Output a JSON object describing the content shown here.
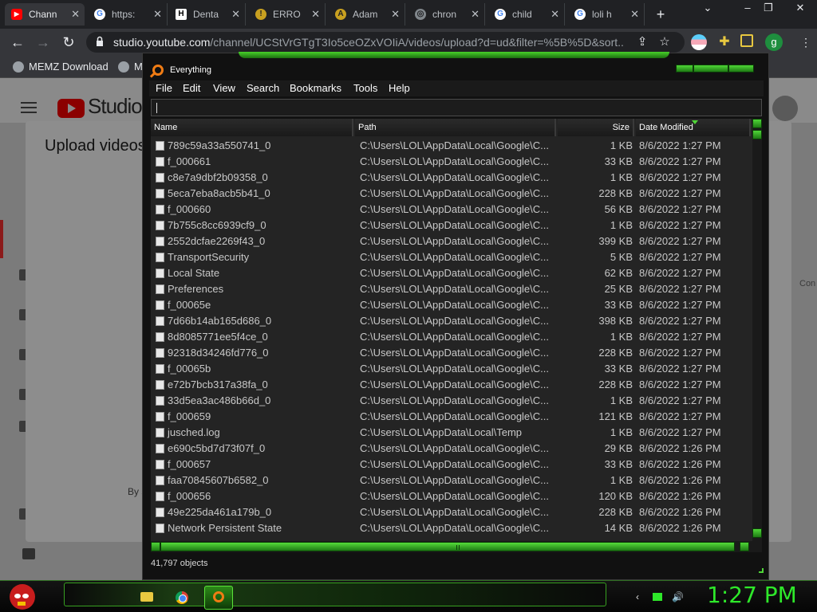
{
  "browser": {
    "tabs": [
      {
        "label": "Chann",
        "favicon": "youtube-icon",
        "active": true
      },
      {
        "label": "https:",
        "favicon": "google-icon",
        "active": false
      },
      {
        "label": "Denta",
        "favicon": "h-icon",
        "active": false
      },
      {
        "label": "ERRO",
        "favicon": "error-icon",
        "active": false
      },
      {
        "label": "Adam",
        "favicon": "adam-icon",
        "active": false
      },
      {
        "label": "chron",
        "favicon": "globe-icon",
        "active": false
      },
      {
        "label": "child",
        "favicon": "google-icon",
        "active": false
      },
      {
        "label": "loli h",
        "favicon": "google-icon",
        "active": false
      }
    ],
    "new_tab": "+",
    "url_domain": "studio.youtube.com",
    "url_path": "/channel/UCStVrGTgT3Io5ceOZxVOIiA/videos/upload?d=ud&filter=%5B%5D&sort...",
    "profile_initial": "g",
    "bookmarks": [
      "MEMZ Download",
      "M"
    ]
  },
  "studio": {
    "logo_text": "Studio",
    "dialog_title": "Upload videos",
    "dialog_footer": "By s",
    "side_text": "Con"
  },
  "everything": {
    "title": "Everything",
    "menu": [
      "File",
      "Edit",
      "View",
      "Search",
      "Bookmarks",
      "Tools",
      "Help"
    ],
    "search_value": "",
    "columns": {
      "name": "Name",
      "path": "Path",
      "size": "Size",
      "date": "Date Modified"
    },
    "rows": [
      {
        "name": "789c59a33a550741_0",
        "path": "C:\\Users\\LOL\\AppData\\Local\\Google\\C...",
        "size": "1 KB",
        "date": "8/6/2022 1:27 PM"
      },
      {
        "name": "f_000661",
        "path": "C:\\Users\\LOL\\AppData\\Local\\Google\\C...",
        "size": "33 KB",
        "date": "8/6/2022 1:27 PM"
      },
      {
        "name": "c8e7a9dbf2b09358_0",
        "path": "C:\\Users\\LOL\\AppData\\Local\\Google\\C...",
        "size": "1 KB",
        "date": "8/6/2022 1:27 PM"
      },
      {
        "name": "5eca7eba8acb5b41_0",
        "path": "C:\\Users\\LOL\\AppData\\Local\\Google\\C...",
        "size": "228 KB",
        "date": "8/6/2022 1:27 PM"
      },
      {
        "name": "f_000660",
        "path": "C:\\Users\\LOL\\AppData\\Local\\Google\\C...",
        "size": "56 KB",
        "date": "8/6/2022 1:27 PM"
      },
      {
        "name": "7b755c8cc6939cf9_0",
        "path": "C:\\Users\\LOL\\AppData\\Local\\Google\\C...",
        "size": "1 KB",
        "date": "8/6/2022 1:27 PM"
      },
      {
        "name": "2552dcfae2269f43_0",
        "path": "C:\\Users\\LOL\\AppData\\Local\\Google\\C...",
        "size": "399 KB",
        "date": "8/6/2022 1:27 PM"
      },
      {
        "name": "TransportSecurity",
        "path": "C:\\Users\\LOL\\AppData\\Local\\Google\\C...",
        "size": "5 KB",
        "date": "8/6/2022 1:27 PM"
      },
      {
        "name": "Local State",
        "path": "C:\\Users\\LOL\\AppData\\Local\\Google\\C...",
        "size": "62 KB",
        "date": "8/6/2022 1:27 PM"
      },
      {
        "name": "Preferences",
        "path": "C:\\Users\\LOL\\AppData\\Local\\Google\\C...",
        "size": "25 KB",
        "date": "8/6/2022 1:27 PM"
      },
      {
        "name": "f_00065e",
        "path": "C:\\Users\\LOL\\AppData\\Local\\Google\\C...",
        "size": "33 KB",
        "date": "8/6/2022 1:27 PM"
      },
      {
        "name": "7d66b14ab165d686_0",
        "path": "C:\\Users\\LOL\\AppData\\Local\\Google\\C...",
        "size": "398 KB",
        "date": "8/6/2022 1:27 PM"
      },
      {
        "name": "8d8085771ee5f4ce_0",
        "path": "C:\\Users\\LOL\\AppData\\Local\\Google\\C...",
        "size": "1 KB",
        "date": "8/6/2022 1:27 PM"
      },
      {
        "name": "92318d34246fd776_0",
        "path": "C:\\Users\\LOL\\AppData\\Local\\Google\\C...",
        "size": "228 KB",
        "date": "8/6/2022 1:27 PM"
      },
      {
        "name": "f_00065b",
        "path": "C:\\Users\\LOL\\AppData\\Local\\Google\\C...",
        "size": "33 KB",
        "date": "8/6/2022 1:27 PM"
      },
      {
        "name": "e72b7bcb317a38fa_0",
        "path": "C:\\Users\\LOL\\AppData\\Local\\Google\\C...",
        "size": "228 KB",
        "date": "8/6/2022 1:27 PM"
      },
      {
        "name": "33d5ea3ac486b66d_0",
        "path": "C:\\Users\\LOL\\AppData\\Local\\Google\\C...",
        "size": "1 KB",
        "date": "8/6/2022 1:27 PM"
      },
      {
        "name": "f_000659",
        "path": "C:\\Users\\LOL\\AppData\\Local\\Google\\C...",
        "size": "121 KB",
        "date": "8/6/2022 1:27 PM"
      },
      {
        "name": "jusched.log",
        "path": "C:\\Users\\LOL\\AppData\\Local\\Temp",
        "size": "1 KB",
        "date": "8/6/2022 1:27 PM"
      },
      {
        "name": "e690c5bd7d73f07f_0",
        "path": "C:\\Users\\LOL\\AppData\\Local\\Google\\C...",
        "size": "29 KB",
        "date": "8/6/2022 1:26 PM"
      },
      {
        "name": "f_000657",
        "path": "C:\\Users\\LOL\\AppData\\Local\\Google\\C...",
        "size": "33 KB",
        "date": "8/6/2022 1:26 PM"
      },
      {
        "name": "faa70845607b6582_0",
        "path": "C:\\Users\\LOL\\AppData\\Local\\Google\\C...",
        "size": "1 KB",
        "date": "8/6/2022 1:26 PM"
      },
      {
        "name": "f_000656",
        "path": "C:\\Users\\LOL\\AppData\\Local\\Google\\C...",
        "size": "120 KB",
        "date": "8/6/2022 1:26 PM"
      },
      {
        "name": "49e225da461a179b_0",
        "path": "C:\\Users\\LOL\\AppData\\Local\\Google\\C...",
        "size": "228 KB",
        "date": "8/6/2022 1:26 PM"
      },
      {
        "name": "Network Persistent State",
        "path": "C:\\Users\\LOL\\AppData\\Local\\Google\\C...",
        "size": "14 KB",
        "date": "8/6/2022 1:26 PM"
      }
    ],
    "status": "41,797 objects",
    "accent_color": "#4fd637"
  },
  "taskbar": {
    "apps": [
      "file-explorer-icon",
      "chrome-icon",
      "everything-search-icon"
    ],
    "clock": "1:27 PM",
    "tray": [
      "back-arrow-icon",
      "network-icon",
      "volume-icon"
    ]
  }
}
